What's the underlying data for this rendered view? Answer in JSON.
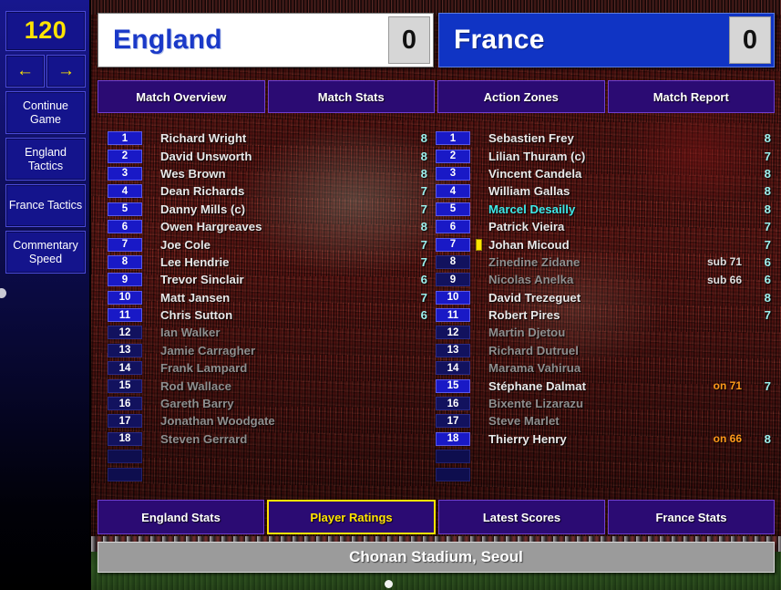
{
  "sidebar": {
    "timer": "120",
    "arrow_left": "←",
    "arrow_right": "→",
    "buttons": [
      {
        "label": "Continue Game"
      },
      {
        "label": "England Tactics"
      },
      {
        "label": "France Tactics"
      },
      {
        "label": "Commentary Speed"
      }
    ]
  },
  "header": {
    "home": {
      "name": "England",
      "score": "0"
    },
    "away": {
      "name": "France",
      "score": "0"
    }
  },
  "top_tabs": [
    {
      "label": "Match Overview",
      "active": false
    },
    {
      "label": "Match Stats",
      "active": false
    },
    {
      "label": "Action Zones",
      "active": false
    },
    {
      "label": "Match Report",
      "active": false
    }
  ],
  "bottom_tabs": [
    {
      "label": "England Stats",
      "active": false
    },
    {
      "label": "Player Ratings",
      "active": true
    },
    {
      "label": "Latest Scores",
      "active": false
    },
    {
      "label": "France Stats",
      "active": false
    }
  ],
  "colors": {
    "accent_yellow": "#ffe400",
    "rating_cyan": "#9df2ef",
    "mom_cyan": "#3fe8e8",
    "sub_on_orange": "#ff9b1a",
    "tab_purple": "#2b0b73"
  },
  "home_squad": [
    {
      "num": "1",
      "name": "Richard Wright",
      "rating": "8",
      "event": "",
      "sub": false,
      "mom": false,
      "card": false
    },
    {
      "num": "2",
      "name": "David Unsworth",
      "rating": "8",
      "event": "",
      "sub": false,
      "mom": false,
      "card": false
    },
    {
      "num": "3",
      "name": "Wes Brown",
      "rating": "8",
      "event": "",
      "sub": false,
      "mom": false,
      "card": false
    },
    {
      "num": "4",
      "name": "Dean Richards",
      "rating": "7",
      "event": "",
      "sub": false,
      "mom": false,
      "card": false
    },
    {
      "num": "5",
      "name": "Danny Mills (c)",
      "rating": "7",
      "event": "",
      "sub": false,
      "mom": false,
      "card": false
    },
    {
      "num": "6",
      "name": "Owen Hargreaves",
      "rating": "8",
      "event": "",
      "sub": false,
      "mom": false,
      "card": false
    },
    {
      "num": "7",
      "name": "Joe Cole",
      "rating": "7",
      "event": "",
      "sub": false,
      "mom": false,
      "card": false
    },
    {
      "num": "8",
      "name": "Lee Hendrie",
      "rating": "7",
      "event": "",
      "sub": false,
      "mom": false,
      "card": false
    },
    {
      "num": "9",
      "name": "Trevor Sinclair",
      "rating": "6",
      "event": "",
      "sub": false,
      "mom": false,
      "card": false
    },
    {
      "num": "10",
      "name": "Matt Jansen",
      "rating": "7",
      "event": "",
      "sub": false,
      "mom": false,
      "card": false
    },
    {
      "num": "11",
      "name": "Chris Sutton",
      "rating": "6",
      "event": "",
      "sub": false,
      "mom": false,
      "card": false
    },
    {
      "num": "12",
      "name": "Ian Walker",
      "rating": "",
      "event": "",
      "sub": true,
      "mom": false,
      "card": false
    },
    {
      "num": "13",
      "name": "Jamie Carragher",
      "rating": "",
      "event": "",
      "sub": true,
      "mom": false,
      "card": false
    },
    {
      "num": "14",
      "name": "Frank Lampard",
      "rating": "",
      "event": "",
      "sub": true,
      "mom": false,
      "card": false
    },
    {
      "num": "15",
      "name": "Rod Wallace",
      "rating": "",
      "event": "",
      "sub": true,
      "mom": false,
      "card": false
    },
    {
      "num": "16",
      "name": "Gareth Barry",
      "rating": "",
      "event": "",
      "sub": true,
      "mom": false,
      "card": false
    },
    {
      "num": "17",
      "name": "Jonathan Woodgate",
      "rating": "",
      "event": "",
      "sub": true,
      "mom": false,
      "card": false
    },
    {
      "num": "18",
      "name": "Steven Gerrard",
      "rating": "",
      "event": "",
      "sub": true,
      "mom": false,
      "card": false
    },
    {
      "num": "",
      "name": "",
      "rating": "",
      "event": "",
      "sub": true,
      "mom": false,
      "card": false,
      "empty": true
    },
    {
      "num": "",
      "name": "",
      "rating": "",
      "event": "",
      "sub": true,
      "mom": false,
      "card": false,
      "empty": true
    }
  ],
  "away_squad": [
    {
      "num": "1",
      "name": "Sebastien Frey",
      "rating": "8",
      "event": "",
      "sub": false,
      "mom": false,
      "card": false
    },
    {
      "num": "2",
      "name": "Lilian Thuram (c)",
      "rating": "7",
      "event": "",
      "sub": false,
      "mom": false,
      "card": false
    },
    {
      "num": "3",
      "name": "Vincent Candela",
      "rating": "8",
      "event": "",
      "sub": false,
      "mom": false,
      "card": false
    },
    {
      "num": "4",
      "name": "William Gallas",
      "rating": "8",
      "event": "",
      "sub": false,
      "mom": false,
      "card": false
    },
    {
      "num": "5",
      "name": "Marcel Desailly",
      "rating": "8",
      "event": "",
      "sub": false,
      "mom": true,
      "card": false
    },
    {
      "num": "6",
      "name": "Patrick Vieira",
      "rating": "7",
      "event": "",
      "sub": false,
      "mom": false,
      "card": false
    },
    {
      "num": "7",
      "name": "Johan Micoud",
      "rating": "7",
      "event": "",
      "sub": false,
      "mom": false,
      "card": true
    },
    {
      "num": "8",
      "name": "Zinedine Zidane",
      "rating": "6",
      "event": "sub 71",
      "sub": true,
      "mom": false,
      "card": false
    },
    {
      "num": "9",
      "name": "Nicolas Anelka",
      "rating": "6",
      "event": "sub 66",
      "sub": true,
      "mom": false,
      "card": false
    },
    {
      "num": "10",
      "name": "David Trezeguet",
      "rating": "8",
      "event": "",
      "sub": false,
      "mom": false,
      "card": false
    },
    {
      "num": "11",
      "name": "Robert Pires",
      "rating": "7",
      "event": "",
      "sub": false,
      "mom": false,
      "card": false
    },
    {
      "num": "12",
      "name": "Martin Djetou",
      "rating": "",
      "event": "",
      "sub": true,
      "mom": false,
      "card": false
    },
    {
      "num": "13",
      "name": "Richard Dutruel",
      "rating": "",
      "event": "",
      "sub": true,
      "mom": false,
      "card": false
    },
    {
      "num": "14",
      "name": "Marama Vahirua",
      "rating": "",
      "event": "",
      "sub": true,
      "mom": false,
      "card": false
    },
    {
      "num": "15",
      "name": "Stéphane Dalmat",
      "rating": "7",
      "event": "on 71",
      "sub": false,
      "mom": false,
      "card": false,
      "on": true
    },
    {
      "num": "16",
      "name": "Bixente Lizarazu",
      "rating": "",
      "event": "",
      "sub": true,
      "mom": false,
      "card": false
    },
    {
      "num": "17",
      "name": "Steve Marlet",
      "rating": "",
      "event": "",
      "sub": true,
      "mom": false,
      "card": false
    },
    {
      "num": "18",
      "name": "Thierry Henry",
      "rating": "8",
      "event": "on 66",
      "sub": false,
      "mom": false,
      "card": false,
      "on": true
    },
    {
      "num": "",
      "name": "",
      "rating": "",
      "event": "",
      "sub": true,
      "mom": false,
      "card": false,
      "empty": true
    },
    {
      "num": "",
      "name": "",
      "rating": "",
      "event": "",
      "sub": true,
      "mom": false,
      "card": false,
      "empty": true
    }
  ],
  "status": {
    "stadium": "Chonan Stadium, Seoul"
  }
}
